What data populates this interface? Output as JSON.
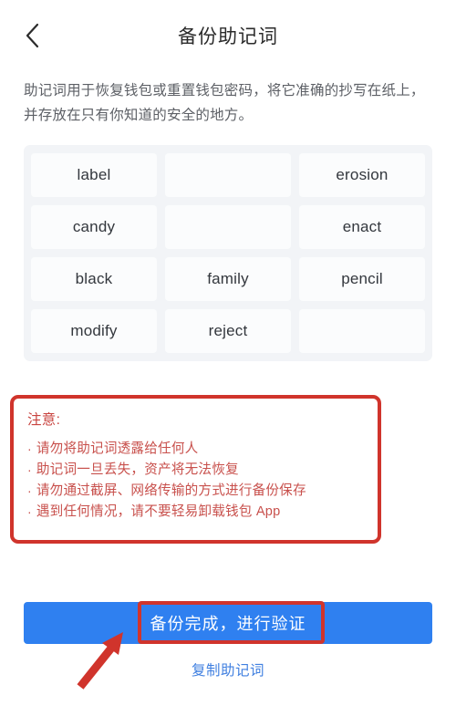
{
  "header": {
    "back_icon": "chevron-left-icon",
    "title": "备份助记词"
  },
  "description": "助记词用于恢复钱包或重置钱包密码，将它准确的抄写在纸上，并存放在只有你知道的安全的地方。",
  "mnemonic": {
    "columns": 3,
    "words": [
      "label",
      "",
      "erosion",
      "candy",
      "",
      "enact",
      "black",
      "family",
      "pencil",
      "modify",
      "reject",
      ""
    ]
  },
  "warning": {
    "title": "注意:",
    "bullet": "·",
    "items": [
      "请勿将助记词透露给任何人",
      "助记词一旦丢失，资产将无法恢复",
      "请勿通过截屏、网络传输的方式进行备份保存",
      "遇到任何情况，请不要轻易卸载钱包 App"
    ]
  },
  "actions": {
    "primary_label": "备份完成，进行验证",
    "copy_label": "复制助记词"
  },
  "annotations": {
    "highlight_target": "备份完成，进行验证",
    "arrow": "red-arrow-icon"
  },
  "colors": {
    "primary_blue": "#2f80f0",
    "annotation_red": "#d0342c",
    "warning_text": "#c8504c",
    "link_blue": "#3f7fe0",
    "grid_background": "#f2f4f7",
    "cell_background": "#fbfcfd"
  }
}
